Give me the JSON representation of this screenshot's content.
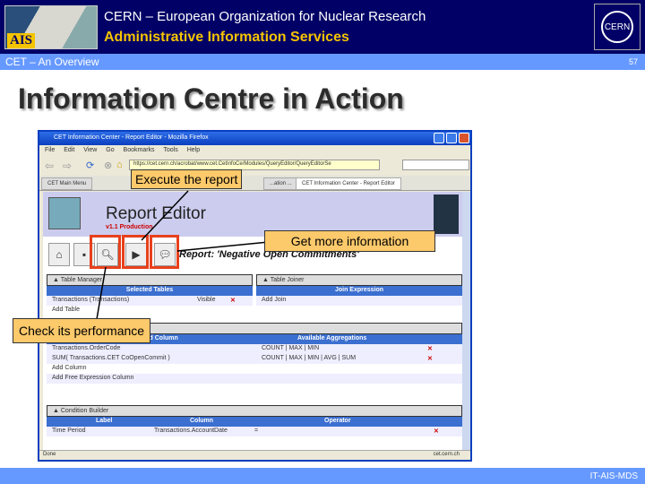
{
  "header": {
    "logo_text": "AIS",
    "org": "CERN – European Organization for Nuclear Research",
    "dept": "Administrative Information Services",
    "cern_logo": "CERN"
  },
  "subbar": {
    "section": "CET – An Overview",
    "page_number": "57"
  },
  "slide_title": "Information Centre in Action",
  "footer": "IT-AIS-MDS",
  "browser": {
    "title": "CET Information Center - Report Editor - Mozilla Firefox",
    "menu": [
      "File",
      "Edit",
      "View",
      "Go",
      "Bookmarks",
      "Tools",
      "Help"
    ],
    "url": "https://cet.cern.ch/acrobat/www.cet.CetInfoCe/Modules/QueryEditor/QueryEditorSe",
    "tabs": [
      "CET Main Menu",
      "...ation ...",
      "CET Information Center - Report Editor"
    ],
    "status_left": "Done",
    "status_right": "cet.cern.ch"
  },
  "report": {
    "title": "Report Editor",
    "version": "v1.1 Production",
    "report_label": "Report: 'Negative Open Commitments'",
    "table_manager": {
      "title": "Table Manager",
      "header": "Selected Tables",
      "rows": [
        {
          "name": "Transactions (Transactions)",
          "state": "Visible"
        }
      ],
      "add": "Add Table"
    },
    "table_joiner": {
      "title": "Table Joiner",
      "header": "Join Expression",
      "add": "Add Join"
    },
    "columns": {
      "headers": [
        "Selected Column",
        "Available Aggregations"
      ],
      "rows": [
        {
          "col": "Transactions.OrderCode",
          "agg": "COUNT | MAX | MIN"
        },
        {
          "col": "SUM( Transactions.CET CoOpenCommit )",
          "agg": "COUNT | MAX | MIN | AVG | SUM"
        }
      ],
      "add": "Add Column",
      "add_free": "Add Free Expression Column"
    },
    "conditions": {
      "title": "Condition Builder",
      "headers": [
        "Label",
        "Column",
        "Operator"
      ],
      "rows": [
        {
          "label": "Time Period",
          "column": "Transactions.AccountDate",
          "op": "="
        }
      ]
    }
  },
  "callouts": {
    "execute": "Execute the report",
    "info": "Get more information",
    "performance": "Check its performance"
  }
}
